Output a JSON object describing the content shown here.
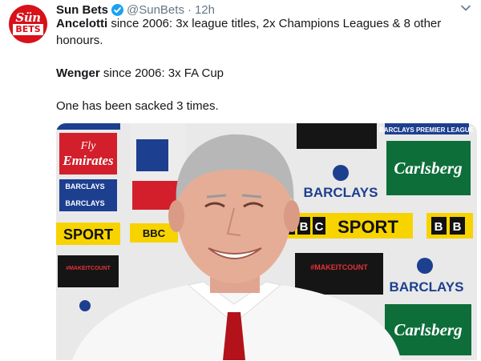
{
  "tweet": {
    "avatar": {
      "line1": "Sün",
      "line2": "BETS"
    },
    "display_name": "Sun Bets",
    "handle": "@SunBets",
    "separator": "·",
    "time": "12h",
    "body": {
      "line1_bold": "Ancelotti",
      "line1_rest": " since 2006: 3x league titles, 2x Champions Leagues & 8 other honours.",
      "line2_bold": "Wenger",
      "line2_rest": " since 2006: 3x FA Cup",
      "line3": "One has been sacked 3 times."
    },
    "photo": {
      "boards": {
        "emirates": "Fly Emirates",
        "barclays": "BARCLAYS",
        "sport": "SPORT",
        "bbc_sport": "SPORT",
        "carlsberg": "Carlsberg",
        "makeitcount": "#MAKEITCOUNT",
        "bb": "BB",
        "bb_left": "BBC",
        "premier": "BARCLAYS PREMIER LEAGUE"
      }
    }
  },
  "colors": {
    "verified": "#1da1f2",
    "muted": "#657786",
    "brand": "#d8111a"
  }
}
